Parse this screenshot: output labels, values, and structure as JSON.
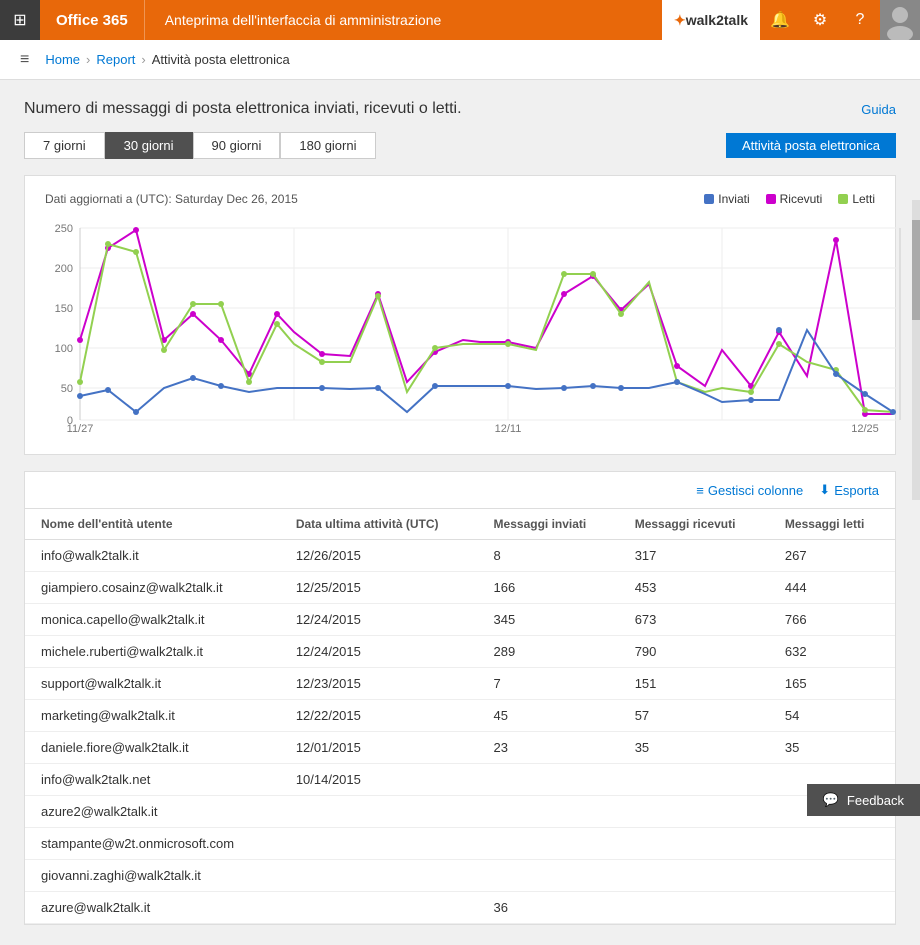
{
  "topbar": {
    "brand": "Office 365",
    "title": "Anteprima dell'interfaccia di amministrazione",
    "logo_text": "walk2talk",
    "logo_star": "✦",
    "icons": {
      "bell": "🔔",
      "gear": "⚙",
      "help": "?"
    }
  },
  "breadcrumb": {
    "hamburger": "≡",
    "home": "Home",
    "report": "Report",
    "current": "Attività posta elettronica"
  },
  "page": {
    "title": "Numero di messaggi di posta elettronica inviati, ricevuti o letti.",
    "guide_label": "Guida"
  },
  "time_filters": [
    {
      "label": "7 giorni",
      "active": false
    },
    {
      "label": "30 giorni",
      "active": true
    },
    {
      "label": "90 giorni",
      "active": false
    },
    {
      "label": "180 giorni",
      "active": false
    }
  ],
  "chart_label_btn": "Attività posta elettronica",
  "chart": {
    "date_label": "Dati aggiornati a (UTC): Saturday Dec 26, 2015",
    "legend": [
      {
        "label": "Inviati",
        "color": "#4472c4"
      },
      {
        "label": "Ricevuti",
        "color": "#cc00cc"
      },
      {
        "label": "Letti",
        "color": "#92d050"
      }
    ],
    "x_labels": [
      "11/27",
      "12/11",
      "12/25"
    ],
    "y_max": 250,
    "y_labels": [
      "250",
      "200",
      "150",
      "100",
      "50",
      "0"
    ]
  },
  "table": {
    "actions": {
      "columns_label": "Gestisci colonne",
      "export_label": "Esporta"
    },
    "headers": [
      "Nome dell'entità utente",
      "Data ultima attività (UTC)",
      "Messaggi inviati",
      "Messaggi ricevuti",
      "Messaggi letti"
    ],
    "rows": [
      {
        "email": "info@walk2talk.it",
        "date": "12/26/2015",
        "sent": "8",
        "received": "317",
        "read": "267"
      },
      {
        "email": "giampiero.cosainz@walk2talk.it",
        "date": "12/25/2015",
        "sent": "166",
        "received": "453",
        "read": "444"
      },
      {
        "email": "monica.capello@walk2talk.it",
        "date": "12/24/2015",
        "sent": "345",
        "received": "673",
        "read": "766"
      },
      {
        "email": "michele.ruberti@walk2talk.it",
        "date": "12/24/2015",
        "sent": "289",
        "received": "790",
        "read": "632"
      },
      {
        "email": "support@walk2talk.it",
        "date": "12/23/2015",
        "sent": "7",
        "received": "151",
        "read": "165"
      },
      {
        "email": "marketing@walk2talk.it",
        "date": "12/22/2015",
        "sent": "45",
        "received": "57",
        "read": "54"
      },
      {
        "email": "daniele.fiore@walk2talk.it",
        "date": "12/01/2015",
        "sent": "23",
        "received": "35",
        "read": "35"
      },
      {
        "email": "info@walk2talk.net",
        "date": "10/14/2015",
        "sent": "",
        "received": "",
        "read": ""
      },
      {
        "email": "azure2@walk2talk.it",
        "date": "",
        "sent": "",
        "received": "",
        "read": ""
      },
      {
        "email": "stampante@w2t.onmicrosoft.com",
        "date": "",
        "sent": "",
        "received": "",
        "read": ""
      },
      {
        "email": "giovanni.zaghi@walk2talk.it",
        "date": "",
        "sent": "",
        "received": "",
        "read": ""
      },
      {
        "email": "azure@walk2talk.it",
        "date": "",
        "sent": "36",
        "received": "",
        "read": ""
      }
    ]
  },
  "feedback": {
    "label": "Feedback",
    "icon": "💬"
  }
}
